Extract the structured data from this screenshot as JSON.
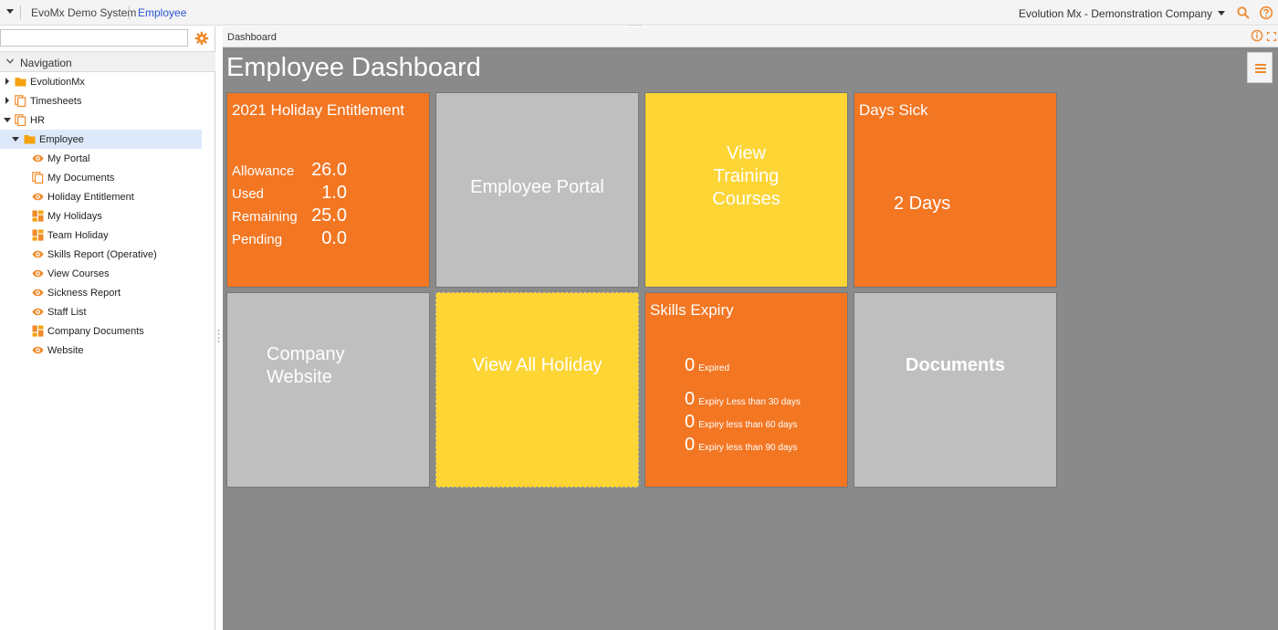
{
  "topbar": {
    "app_name": "EvoMx Demo System",
    "active_crumb": "Employee",
    "company": "Evolution Mx - Demonstration Company",
    "grip": "....."
  },
  "sidebar": {
    "search_placeholder": "",
    "nav_title": "Navigation",
    "items": [
      {
        "label": "EvolutionMx",
        "icon": "folder-icon"
      },
      {
        "label": "Timesheets",
        "icon": "pages-icon"
      },
      {
        "label": "HR",
        "icon": "pages-icon"
      },
      {
        "label": "Employee",
        "icon": "folder-icon"
      },
      {
        "label": "My Portal",
        "icon": "eye-icon"
      },
      {
        "label": "My Documents",
        "icon": "pages-icon"
      },
      {
        "label": "Holiday Entitlement",
        "icon": "eye-icon"
      },
      {
        "label": "My Holidays",
        "icon": "dashboard-icon"
      },
      {
        "label": "Team Holiday",
        "icon": "dashboard-icon"
      },
      {
        "label": "Skills Report (Operative)",
        "icon": "eye-icon"
      },
      {
        "label": "View Courses",
        "icon": "eye-icon"
      },
      {
        "label": "Sickness Report",
        "icon": "eye-icon"
      },
      {
        "label": "Staff List",
        "icon": "eye-icon"
      },
      {
        "label": "Company Documents",
        "icon": "dashboard-icon"
      },
      {
        "label": "Website",
        "icon": "eye-icon"
      }
    ]
  },
  "main": {
    "tab_label": "Dashboard",
    "page_title": "Employee Dashboard",
    "tiles": {
      "holiday": {
        "title": "2021 Holiday Entitlement",
        "rows": [
          {
            "label": "Allowance",
            "value": "26.0"
          },
          {
            "label": "Used",
            "value": "1.0"
          },
          {
            "label": "Remaining",
            "value": "25.0"
          },
          {
            "label": "Pending",
            "value": "0.0"
          }
        ]
      },
      "employee_portal": {
        "label": "Employee Portal"
      },
      "training": {
        "line1": "View",
        "line2": "Training",
        "line3": "Courses"
      },
      "sick": {
        "title": "Days Sick",
        "value": "2 Days"
      },
      "website": {
        "line1": "Company",
        "line2": "Website"
      },
      "all_holiday": {
        "label": "View All Holiday"
      },
      "skills": {
        "title": "Skills Expiry",
        "rows": [
          {
            "count": "0",
            "label": "Expired"
          },
          {
            "count": "0",
            "label": "Expiry Less than 30 days"
          },
          {
            "count": "0",
            "label": "Expiry less than 60 days"
          },
          {
            "count": "0",
            "label": "Expiry less than 90 days"
          }
        ]
      },
      "documents": {
        "label": "Documents"
      }
    }
  },
  "colors": {
    "orange": "#f37623",
    "grey": "#bfbfbf",
    "yellow": "#fdd535",
    "background": "#8a8a8a",
    "link": "#2a55d4"
  }
}
